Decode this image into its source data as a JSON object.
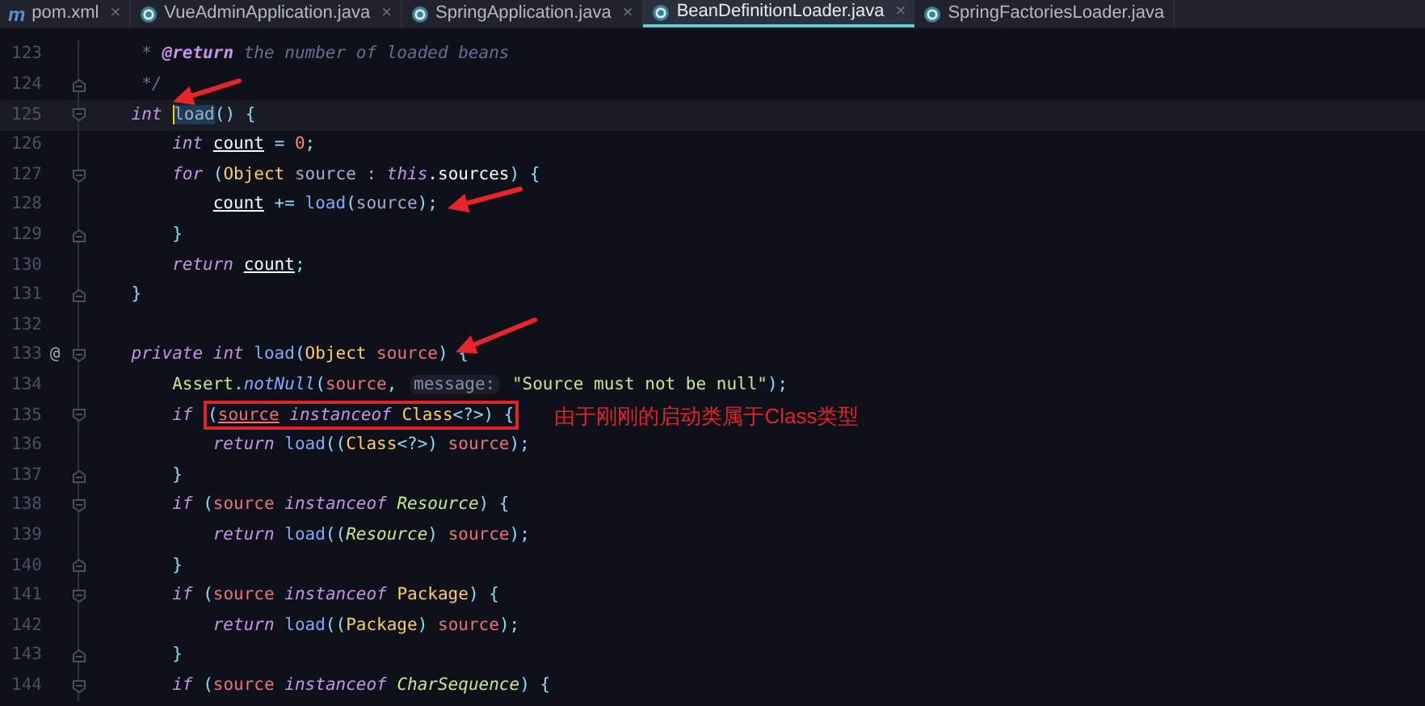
{
  "tabs": [
    {
      "label": "pom.xml",
      "kind": "maven",
      "icon": "m",
      "selected": false,
      "closable": true
    },
    {
      "label": "VueAdminApplication.java",
      "kind": "java",
      "selected": false,
      "closable": true
    },
    {
      "label": "SpringApplication.java",
      "kind": "java",
      "selected": false,
      "closable": true
    },
    {
      "label": "BeanDefinitionLoader.java",
      "kind": "java",
      "selected": true,
      "closable": true
    },
    {
      "label": "SpringFactoriesLoader.java",
      "kind": "java",
      "selected": false,
      "closable": false
    }
  ],
  "close_glyph": "×",
  "editor": {
    "lines": [
      {
        "number": "123",
        "tokens": [
          {
            "text": "     * ",
            "kind": "comment"
          },
          {
            "text": "@return",
            "kind": "doctag"
          },
          {
            "text": " the number of loaded beans",
            "kind": "comment"
          }
        ]
      },
      {
        "number": "124",
        "fold_end": true,
        "tokens": [
          {
            "text": "     */",
            "kind": "comment"
          }
        ]
      },
      {
        "number": "125",
        "fold_start": true,
        "current": true,
        "tokens": [
          {
            "text": "    int ",
            "kind": "keyword"
          },
          {
            "text": "load",
            "kind": "selected"
          },
          {
            "text": "() {",
            "kind": "punct"
          }
        ]
      },
      {
        "number": "126",
        "tokens": [
          {
            "text": "        int ",
            "kind": "keyword"
          },
          {
            "text": "count",
            "kind": "variable"
          },
          {
            "text": " = ",
            "kind": "punct"
          },
          {
            "text": "0",
            "kind": "number"
          },
          {
            "text": ";",
            "kind": "punct"
          }
        ]
      },
      {
        "number": "127",
        "fold_start": true,
        "tokens": [
          {
            "text": "        for",
            "kind": "keyword"
          },
          {
            "text": " (",
            "kind": "punct"
          },
          {
            "text": "Object",
            "kind": "type"
          },
          {
            "text": " source : ",
            "kind": "plain"
          },
          {
            "text": "this",
            "kind": "keyword"
          },
          {
            "text": ".sources",
            "kind": "field"
          },
          {
            "text": ") {",
            "kind": "punct"
          }
        ]
      },
      {
        "number": "128",
        "tokens": [
          {
            "text": "            count",
            "kind": "variable"
          },
          {
            "text": " += ",
            "kind": "punct"
          },
          {
            "text": "load",
            "kind": "function"
          },
          {
            "text": "(",
            "kind": "punct"
          },
          {
            "text": "source",
            "kind": "plain"
          },
          {
            "text": ");",
            "kind": "punct"
          }
        ]
      },
      {
        "number": "129",
        "fold_end": true,
        "tokens": [
          {
            "text": "        }",
            "kind": "punct"
          }
        ]
      },
      {
        "number": "130",
        "tokens": [
          {
            "text": "        return ",
            "kind": "keyword"
          },
          {
            "text": "count",
            "kind": "variable"
          },
          {
            "text": ";",
            "kind": "punct"
          }
        ]
      },
      {
        "number": "131",
        "fold_end": true,
        "tokens": [
          {
            "text": "    }",
            "kind": "punct"
          }
        ]
      },
      {
        "number": "132"
      },
      {
        "number": "133",
        "fold_start": true,
        "marker": "@",
        "tokens": [
          {
            "text": "    private int ",
            "kind": "keyword"
          },
          {
            "text": "load",
            "kind": "function"
          },
          {
            "text": "(",
            "kind": "punct"
          },
          {
            "text": "Object ",
            "kind": "type"
          },
          {
            "text": "source",
            "kind": "param"
          },
          {
            "text": ") {",
            "kind": "punct"
          }
        ]
      },
      {
        "number": "134",
        "tokens": [
          {
            "text": "        Assert",
            "kind": "class"
          },
          {
            "text": ".",
            "kind": "punct"
          },
          {
            "text": "notNull",
            "kind": "static"
          },
          {
            "text": "(",
            "kind": "punct"
          },
          {
            "text": "source",
            "kind": "param"
          },
          {
            "text": ", ",
            "kind": "punct"
          },
          {
            "text": "message:",
            "kind": "hint"
          },
          {
            "text": " \"Source must not be null\"",
            "kind": "string"
          },
          {
            "text": ");",
            "kind": "punct"
          }
        ]
      },
      {
        "number": "135",
        "fold_start": true,
        "note": "由于刚刚的启动类属于Class类型",
        "tokens": [
          {
            "text": "        if ",
            "kind": "keyword"
          },
          {
            "kind": "box",
            "tokens": [
              {
                "text": "(",
                "kind": "punct"
              },
              {
                "text": "source",
                "kind": "param-var"
              },
              {
                "text": " instanceof ",
                "kind": "keyword"
              },
              {
                "text": "Class",
                "kind": "type"
              },
              {
                "text": "<?>",
                "kind": "punct"
              },
              {
                "text": ") {",
                "kind": "punct"
              }
            ]
          }
        ]
      },
      {
        "number": "136",
        "tokens": [
          {
            "text": "            return ",
            "kind": "keyword"
          },
          {
            "text": "load",
            "kind": "function"
          },
          {
            "text": "((",
            "kind": "punct"
          },
          {
            "text": "Class",
            "kind": "type"
          },
          {
            "text": "<?>) ",
            "kind": "punct"
          },
          {
            "text": "source",
            "kind": "param"
          },
          {
            "text": ");",
            "kind": "punct"
          }
        ]
      },
      {
        "number": "137",
        "fold_end": true,
        "tokens": [
          {
            "text": "        }",
            "kind": "punct"
          }
        ]
      },
      {
        "number": "138",
        "fold_start": true,
        "tokens": [
          {
            "text": "        if",
            "kind": "keyword"
          },
          {
            "text": " (",
            "kind": "punct"
          },
          {
            "text": "source ",
            "kind": "param"
          },
          {
            "text": "instanceof ",
            "kind": "keyword"
          },
          {
            "text": "Resource",
            "kind": "interface"
          },
          {
            "text": ") {",
            "kind": "punct"
          }
        ]
      },
      {
        "number": "139",
        "tokens": [
          {
            "text": "            return ",
            "kind": "keyword"
          },
          {
            "text": "load",
            "kind": "function"
          },
          {
            "text": "((",
            "kind": "punct"
          },
          {
            "text": "Resource",
            "kind": "interface"
          },
          {
            "text": ") ",
            "kind": "punct"
          },
          {
            "text": "source",
            "kind": "param"
          },
          {
            "text": ");",
            "kind": "punct"
          }
        ]
      },
      {
        "number": "140",
        "fold_end": true,
        "tokens": [
          {
            "text": "        }",
            "kind": "punct"
          }
        ]
      },
      {
        "number": "141",
        "fold_start": true,
        "tokens": [
          {
            "text": "        if",
            "kind": "keyword"
          },
          {
            "text": " (",
            "kind": "punct"
          },
          {
            "text": "source ",
            "kind": "param"
          },
          {
            "text": "instanceof ",
            "kind": "keyword"
          },
          {
            "text": "Package",
            "kind": "type"
          },
          {
            "text": ") {",
            "kind": "punct"
          }
        ]
      },
      {
        "number": "142",
        "tokens": [
          {
            "text": "            return ",
            "kind": "keyword"
          },
          {
            "text": "load",
            "kind": "function"
          },
          {
            "text": "((",
            "kind": "punct"
          },
          {
            "text": "Package",
            "kind": "type"
          },
          {
            "text": ") ",
            "kind": "punct"
          },
          {
            "text": "source",
            "kind": "param"
          },
          {
            "text": ");",
            "kind": "punct"
          }
        ]
      },
      {
        "number": "143",
        "fold_end": true,
        "tokens": [
          {
            "text": "        }",
            "kind": "punct"
          }
        ]
      },
      {
        "number": "144",
        "fold_start": true,
        "tokens": [
          {
            "text": "        if",
            "kind": "keyword"
          },
          {
            "text": " (",
            "kind": "punct"
          },
          {
            "text": "source ",
            "kind": "param"
          },
          {
            "text": "instanceof ",
            "kind": "keyword"
          },
          {
            "text": "CharSequence",
            "kind": "interface"
          },
          {
            "text": ") {",
            "kind": "punct"
          }
        ]
      }
    ]
  }
}
